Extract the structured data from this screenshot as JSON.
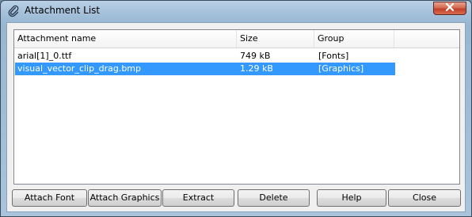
{
  "window": {
    "title": "Attachment List",
    "icon": "paperclip-icon",
    "close_icon": "close-icon"
  },
  "list": {
    "columns": [
      "Attachment name",
      "Size",
      "Group"
    ],
    "rows": [
      {
        "name": "arial[1]_0.ttf",
        "size": "749 kB",
        "group": "[Fonts]",
        "selected": false
      },
      {
        "name": "visual_vector_clip_drag.bmp",
        "size": "1.29 kB",
        "group": "[Graphics]",
        "selected": true
      }
    ]
  },
  "buttons": {
    "attach_font": "Attach Font",
    "attach_graphics": "Attach Graphics",
    "extract": "Extract",
    "delete": "Delete",
    "help": "Help",
    "close": "Close"
  },
  "colors": {
    "selection": "#3399ff",
    "close_button": "#c2402a"
  }
}
